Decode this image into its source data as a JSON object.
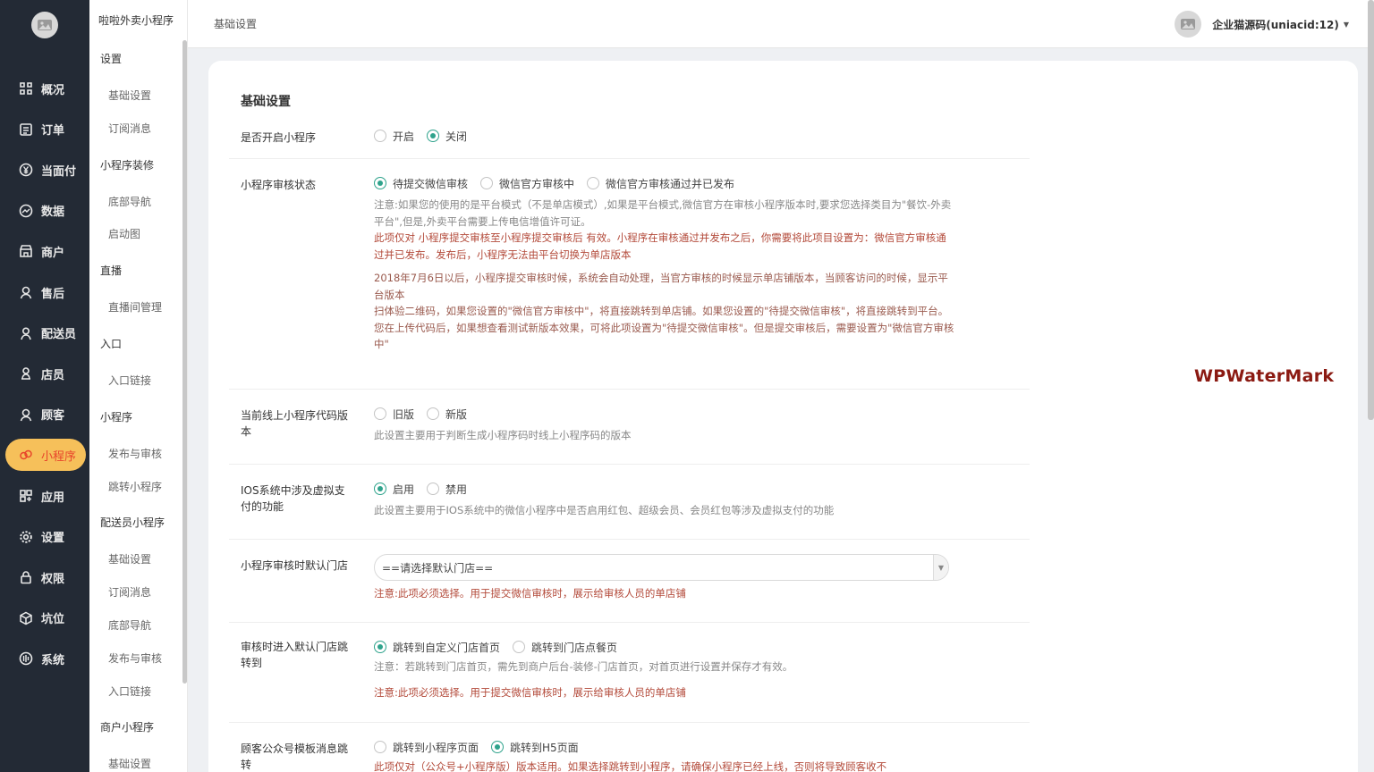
{
  "nav": {
    "items": [
      {
        "label": "概况",
        "icon": "overview-icon"
      },
      {
        "label": "订单",
        "icon": "order-icon"
      },
      {
        "label": "当面付",
        "icon": "yen-icon"
      },
      {
        "label": "数据",
        "icon": "data-icon"
      },
      {
        "label": "商户",
        "icon": "store-icon"
      },
      {
        "label": "售后",
        "icon": "after-sale-icon"
      },
      {
        "label": "配送员",
        "icon": "courier-icon"
      },
      {
        "label": "店员",
        "icon": "clerk-icon"
      },
      {
        "label": "顾客",
        "icon": "customer-icon"
      },
      {
        "label": "小程序",
        "icon": "miniprogram-icon"
      },
      {
        "label": "应用",
        "icon": "apps-icon"
      },
      {
        "label": "设置",
        "icon": "gear-icon"
      },
      {
        "label": "权限",
        "icon": "lock-icon"
      },
      {
        "label": "坑位",
        "icon": "cube-icon"
      },
      {
        "label": "系统",
        "icon": "system-icon"
      }
    ],
    "active_color": "#f6c05a"
  },
  "subnav": {
    "app_name": "啦啦外卖小程序",
    "sections": [
      {
        "title": "设置",
        "items": [
          "基础设置",
          "订阅消息"
        ]
      },
      {
        "title": "小程序装修",
        "items": [
          "底部导航",
          "启动图"
        ]
      },
      {
        "title": "直播",
        "items": [
          "直播间管理"
        ]
      },
      {
        "title": "入口",
        "items": [
          "入口链接"
        ]
      },
      {
        "title": "小程序",
        "items": [
          "发布与审核",
          "跳转小程序"
        ]
      },
      {
        "title": "配送员小程序",
        "items": [
          "基础设置",
          "订阅消息",
          "底部导航",
          "发布与审核",
          "入口链接"
        ]
      },
      {
        "title": "商户小程序",
        "items": [
          "基础设置"
        ]
      }
    ]
  },
  "header": {
    "breadcrumb": "基础设置",
    "user": "企业猫源码(uniacid:12)"
  },
  "card": {
    "title": "基础设置",
    "rows": {
      "enable": {
        "label": "是否开启小程序",
        "options": [
          "开启",
          "关闭"
        ],
        "selected": 1
      },
      "audit": {
        "label": "小程序审核状态",
        "options": [
          "待提交微信审核",
          "微信官方审核中",
          "微信官方审核通过并已发布"
        ],
        "selected": 0,
        "help_gray": "注意:如果您的使用的是平台模式（不是单店模式）,如果是平台模式,微信官方在审核小程序版本时,要求您选择类目为\"餐饮-外卖平台\",但是,外卖平台需要上传电信增值许可证。",
        "help_red": "此项仅对 小程序提交审核至小程序提交审核后 有效。小程序在审核通过并发布之后，你需要将此项目设置为：微信官方审核通过并已发布。发布后，小程序无法由平台切换为单店版本",
        "help_dark": "2018年7月6日以后，小程序提交审核时候，系统会自动处理，当官方审核的时候显示单店铺版本，当顾客访问的时候，显示平台版本\n扫体验二维码，如果您设置的\"微信官方审核中\"，将直接跳转到单店铺。如果您设置的\"待提交微信审核\"，将直接跳转到平台。\n您在上传代码后，如果想查看测试新版本效果，可将此项设置为\"待提交微信审核\"。但是提交审核后，需要设置为\"微信官方审核中\""
      },
      "version": {
        "label": "当前线上小程序代码版本",
        "options": [
          "旧版",
          "新版"
        ],
        "selected": -1,
        "help": "此设置主要用于判断生成小程序码时线上小程序码的版本"
      },
      "ios": {
        "label": "IOS系统中涉及虚拟支付的功能",
        "options": [
          "启用",
          "禁用"
        ],
        "selected": 0,
        "help": "此设置主要用于IOS系统中的微信小程序中是否启用红包、超级会员、会员红包等涉及虚拟支付的功能"
      },
      "default_store": {
        "label": "小程序审核时默认门店",
        "select_value": "==请选择默认门店==",
        "help_red": "注意:此项必须选择。用于提交微信审核时，展示给审核人员的单店铺"
      },
      "jump": {
        "label": "审核时进入默认门店跳转到",
        "options": [
          "跳转到自定义门店首页",
          "跳转到门店点餐页"
        ],
        "selected": 0,
        "help_gray": "注意：若跳转到门店首页，需先到商户后台-装修-门店首页，对首页进行设置并保存才有效。",
        "help_red": "注意:此项必须选择。用于提交微信审核时，展示给审核人员的单店铺"
      },
      "template": {
        "label": "顾客公众号模板消息跳转",
        "options": [
          "跳转到小程序页面",
          "跳转到H5页面"
        ],
        "selected": 1,
        "help": "此项仅对（公众号+小程序版）版本适用。如果选择跳转到小程序，请确保小程序已经上线，否则将导致顾客收不"
      }
    }
  },
  "watermark": "WPWaterMark"
}
